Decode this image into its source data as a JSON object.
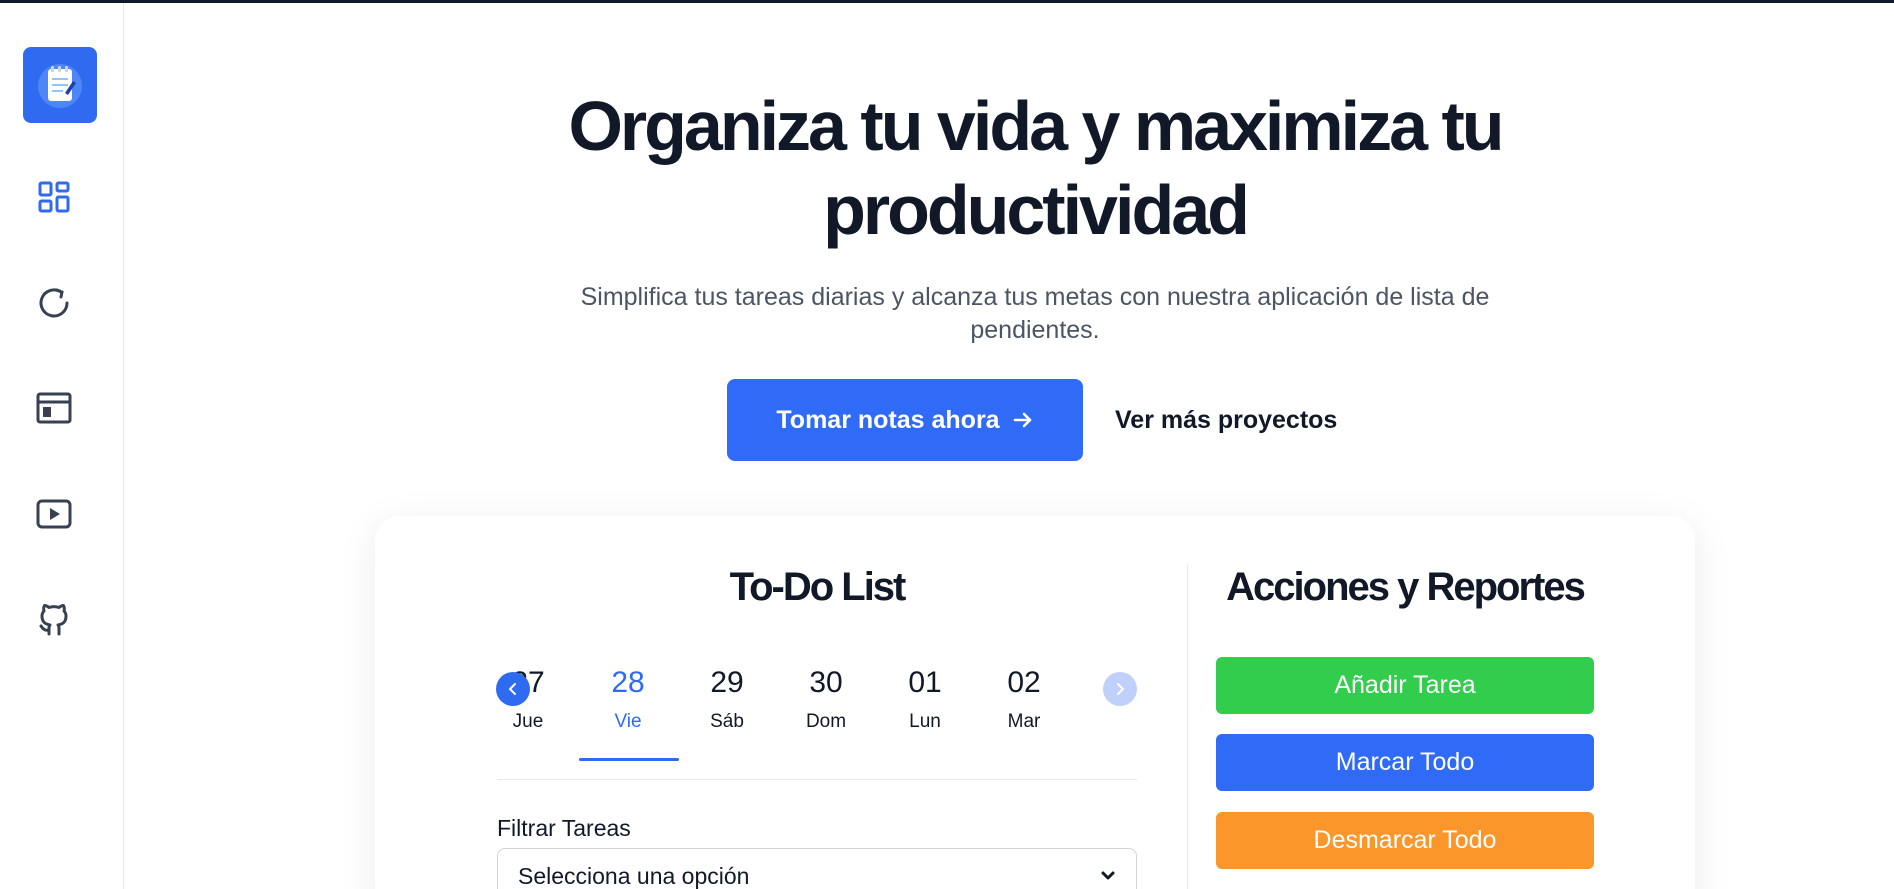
{
  "hero": {
    "title": "Organiza tu vida y maximiza tu productividad",
    "subtitle": "Simplifica tus tareas diarias y alcanza tus metas con nuestra aplicación de lista de pendientes.",
    "primary_button": "Tomar notas ahora",
    "secondary_link": "Ver más proyectos"
  },
  "sidebar": {
    "items": [
      {
        "icon": "dashboard-icon"
      },
      {
        "icon": "refresh-icon"
      },
      {
        "icon": "browser-window-icon"
      },
      {
        "icon": "video-play-icon"
      },
      {
        "icon": "github-icon"
      }
    ]
  },
  "todo": {
    "title": "To-Do List",
    "days": [
      {
        "num": "27",
        "name": "Jue"
      },
      {
        "num": "28",
        "name": "Vie"
      },
      {
        "num": "29",
        "name": "Sáb"
      },
      {
        "num": "30",
        "name": "Dom"
      },
      {
        "num": "01",
        "name": "Lun"
      },
      {
        "num": "02",
        "name": "Mar"
      }
    ],
    "active_day_index": 1,
    "filter_label": "Filtrar Tareas",
    "filter_selected": "Selecciona una opción"
  },
  "actions": {
    "title": "Acciones y Reportes",
    "add": "Añadir Tarea",
    "mark_all": "Marcar Todo",
    "unmark_all": "Desmarcar Todo"
  },
  "colors": {
    "primary": "#2f6bf6",
    "green": "#32cd4d",
    "orange": "#fb962b",
    "text": "#111827"
  }
}
